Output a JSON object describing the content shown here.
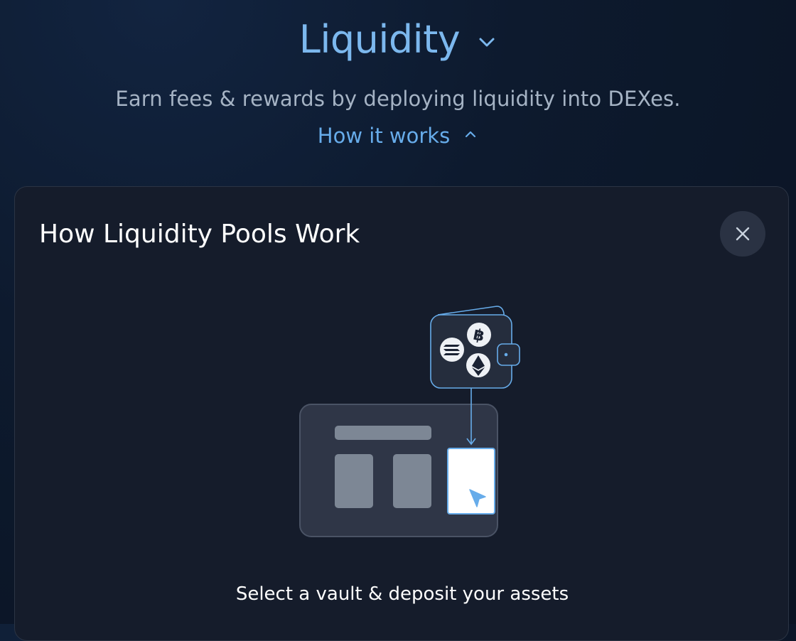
{
  "header": {
    "title": "Liquidity",
    "subtitle": "Earn fees & rewards by deploying liquidity into DEXes.",
    "how_it_works": "How it works"
  },
  "panel": {
    "title": "How Liquidity Pools Work",
    "caption": "Select a vault & deposit your assets"
  },
  "icons": {
    "title_chevron": "chevron-down-icon",
    "how_chevron": "chevron-up-icon",
    "close": "close-icon",
    "wallet": "wallet-icon",
    "coins": [
      "solana-coin-icon",
      "bitcoin-coin-icon",
      "ethereum-coin-icon"
    ],
    "cursor": "cursor-icon"
  },
  "colors": {
    "accent": "#67acea",
    "title": "#7cb8ee",
    "panel_bg": "#151c2b",
    "subtitle": "#a5b3c4"
  }
}
